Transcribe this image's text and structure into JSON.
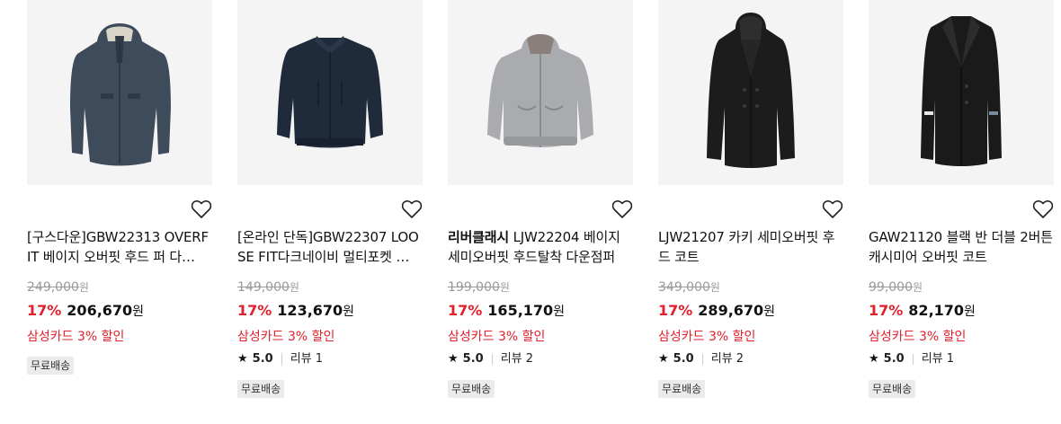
{
  "products": [
    {
      "brand": "",
      "title": "[구스다운]GBW22313 OVERFIT 베이지 오버핏 후드 퍼 다…",
      "original_price": "249,000",
      "original_unit": "원",
      "discount": "17%",
      "price": "206,670",
      "price_unit": "원",
      "promo": "삼성카드 3% 할인",
      "rating": null,
      "review_label": null,
      "badge": "무료배송",
      "image_icon": "navy-hooded-parka-icon"
    },
    {
      "brand": "",
      "title": "[온라인 단독]GBW22307 LOOSE FIT다크네이비 멀티포켓 …",
      "original_price": "149,000",
      "original_unit": "원",
      "discount": "17%",
      "price": "123,670",
      "price_unit": "원",
      "promo": "삼성카드 3% 할인",
      "rating": "5.0",
      "review_label": "리뷰 1",
      "star": "★",
      "badge": "무료배송",
      "image_icon": "navy-blouson-jacket-icon"
    },
    {
      "brand": "리버클래시",
      "title": " LJW22204 베이지 세미오버핏 후드탈착 다운점퍼",
      "original_price": "199,000",
      "original_unit": "원",
      "discount": "17%",
      "price": "165,170",
      "price_unit": "원",
      "promo": "삼성카드 3% 할인",
      "rating": "5.0",
      "review_label": "리뷰 2",
      "star": "★",
      "badge": "무료배송",
      "image_icon": "gray-hooded-down-jacket-icon"
    },
    {
      "brand": "",
      "title": "LJW21207 카키 세미오버핏 후드 코트",
      "original_price": "349,000",
      "original_unit": "원",
      "discount": "17%",
      "price": "289,670",
      "price_unit": "원",
      "promo": "삼성카드 3% 할인",
      "rating": "5.0",
      "review_label": "리뷰 2",
      "star": "★",
      "badge": "무료배송",
      "image_icon": "black-hooded-coat-icon"
    },
    {
      "brand": "",
      "title": "GAW21120 블랙 반 더블 2버튼 캐시미어 오버핏 코트",
      "original_price": "99,000",
      "original_unit": "원",
      "discount": "17%",
      "price": "82,170",
      "price_unit": "원",
      "promo": "삼성카드 3% 할인",
      "rating": "5.0",
      "review_label": "리뷰 1",
      "star": "★",
      "badge": "무료배송",
      "image_icon": "black-overcoat-icon"
    }
  ],
  "colors": {
    "discount": "#e0202b",
    "promo": "#e0202b",
    "original_price": "#999999",
    "thumb_bg": "#f4f4f4",
    "badge_bg": "#ebebeb"
  },
  "icons": {
    "wishlist": "heart-outline-icon",
    "rating": "star-icon"
  }
}
